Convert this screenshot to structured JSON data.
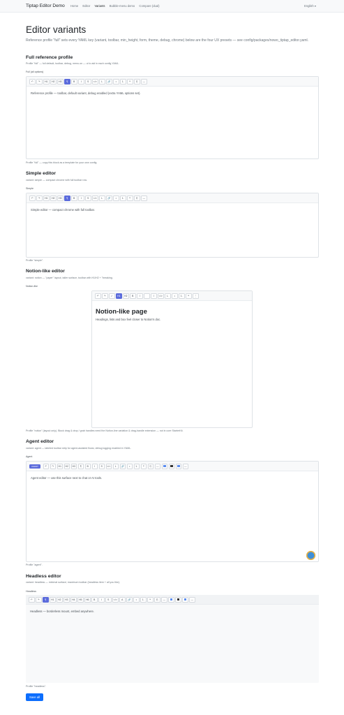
{
  "nav": {
    "brand": "Tiptap Editor Demo",
    "links": [
      "Home",
      "Editor",
      "Variants",
      "Bubble-menu demo",
      "Compare (dual)"
    ],
    "lang": "English"
  },
  "page": {
    "title": "Editor variants",
    "intro": "Reference profile \"full\" sets every YAML key (variant, toolbar, min_height, form, theme, debug, chrome) below are the four UX presets — see config/packages/nowo_tiptap_editor.yaml."
  },
  "variants": [
    {
      "heading": "Full reference profile",
      "sub": "Profile \"full\" — full default, toolbar, debug, menu.on — ui to aid in each config YAML.",
      "label": "Full (all options)",
      "content": "Reference profile — toolbar, default variant, debug enabled (extra YAML options set).",
      "caption": "Profile \"full\" — copy this block as a template for your own config."
    },
    {
      "heading": "Simple editor",
      "sub": "variant: simple — compact chrome with full toolbar row.",
      "label": "Simple",
      "content": "Simple editor — compact chrome with full toolbar.",
      "caption": "Profile \"simple\"."
    },
    {
      "heading": "Notion-like editor",
      "sub": "variant: notion — \"paper\" layout, taller surface, toolbar with H1/H2 + \"breaking.",
      "label": "Notion-like",
      "content_title": "Notion-like page",
      "content": "Headings, lists and box feel closer to Notion's doc.",
      "caption": "Profile \"notion\" (layout only). Block drag & drop / grab handles need the Notion-line variation & drag-handle extension — not in core StarterKit."
    },
    {
      "heading": "Agent editor",
      "sub": "variant: agent — labeled toolbar strip for agent-assisted flows; debug logging enabled in YAML.",
      "label": "Agent",
      "badge": "AGENT",
      "content": "Agent editor — use this surface next to chat or AI tools.",
      "caption": "Profile \"agent\"."
    },
    {
      "heading": "Headless editor",
      "sub": "variant: headless — minimal surface; maximum toolbar (headless item + all you like).",
      "label": "Headless",
      "content": "Headless — borderless mount, embed anywhere.",
      "caption": "Profile \"headless\"."
    }
  ],
  "toolbars": {
    "full": [
      "↶",
      "↷",
      "H1",
      "H2",
      "H3",
      "¶",
      "B",
      "I",
      "S",
      "</>",
      "L",
      "🔗",
      "•",
      "1.",
      "❝",
      "⎘",
      "—"
    ],
    "simple": [
      "↶",
      "↷",
      "H1",
      "H2",
      "H3",
      "¶",
      "B",
      "I",
      "S",
      "</>",
      "L",
      "🔗",
      "•",
      "1.",
      "❝",
      "⎘",
      "—"
    ],
    "notion": [
      "↶",
      "↷",
      "✓",
      "H1",
      "H2",
      "B",
      "I",
      "",
      "I",
      "</>",
      "L",
      "•",
      "1.",
      "❝",
      "⋮"
    ],
    "agent": [
      "↶",
      "↷",
      "H1",
      "H2",
      "H3",
      "¶",
      "B",
      "I",
      "S",
      "</>",
      "L",
      "🔗",
      "•",
      "1.",
      "❝",
      "⎘",
      "—"
    ],
    "headless": [
      "↶",
      "↷",
      "¶",
      "H1",
      "H2",
      "H3",
      "H4",
      "H5",
      "H6",
      "B",
      "I",
      "S",
      "</>",
      "A",
      "🔗",
      "•",
      "1.",
      "❝",
      "⎘",
      "—"
    ]
  },
  "colors": {
    "accent": "#5b6bdc",
    "primary": "#0d6efd"
  },
  "save_label": "Save all"
}
